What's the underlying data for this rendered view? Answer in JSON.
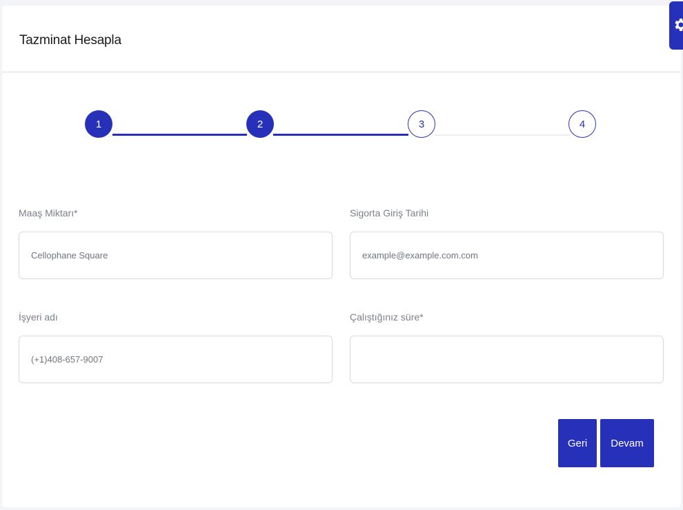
{
  "header": {
    "title": "Tazminat Hesapla"
  },
  "stepper": {
    "steps": [
      {
        "label": "1",
        "state": "done"
      },
      {
        "label": "2",
        "state": "done"
      },
      {
        "label": "3",
        "state": "current"
      },
      {
        "label": "4",
        "state": "todo"
      }
    ]
  },
  "form": {
    "salary": {
      "label": "Maaş Miktarı*",
      "placeholder": "Cellophane Square",
      "value": ""
    },
    "insurance_date": {
      "label": "Sigorta Giriş Tarihi",
      "placeholder": "example@example.com.com",
      "value": ""
    },
    "workplace": {
      "label": "İşyeri adı",
      "placeholder": "(+1)408-657-9007",
      "value": ""
    },
    "duration": {
      "label": "Çalıştığınız süre*",
      "placeholder": "",
      "value": ""
    }
  },
  "actions": {
    "back_label": "Geri",
    "next_label": "Devam"
  },
  "icons": {
    "settings": "gear-icon"
  },
  "colors": {
    "accent": "#2630b8",
    "inactive_line": "#eceef2"
  }
}
